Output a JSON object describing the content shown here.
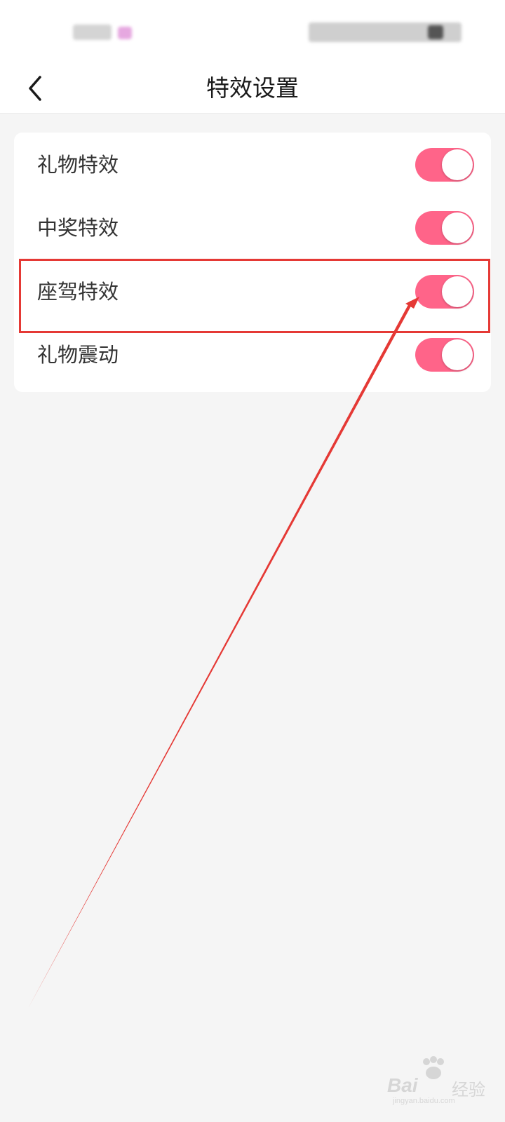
{
  "colors": {
    "toggle_on": "#ff6489",
    "highlight": "#e53935",
    "background": "#f5f5f5",
    "card": "#ffffff"
  },
  "header": {
    "title": "特效设置",
    "back_icon": "chevron-left-icon"
  },
  "settings": [
    {
      "label": "礼物特效",
      "enabled": true
    },
    {
      "label": "中奖特效",
      "enabled": true
    },
    {
      "label": "座驾特效",
      "enabled": true
    },
    {
      "label": "礼物震动",
      "enabled": true
    }
  ],
  "watermark": {
    "brand": "Bai",
    "brand_cn": "经验",
    "domain": "jingyan.baidu.com"
  }
}
